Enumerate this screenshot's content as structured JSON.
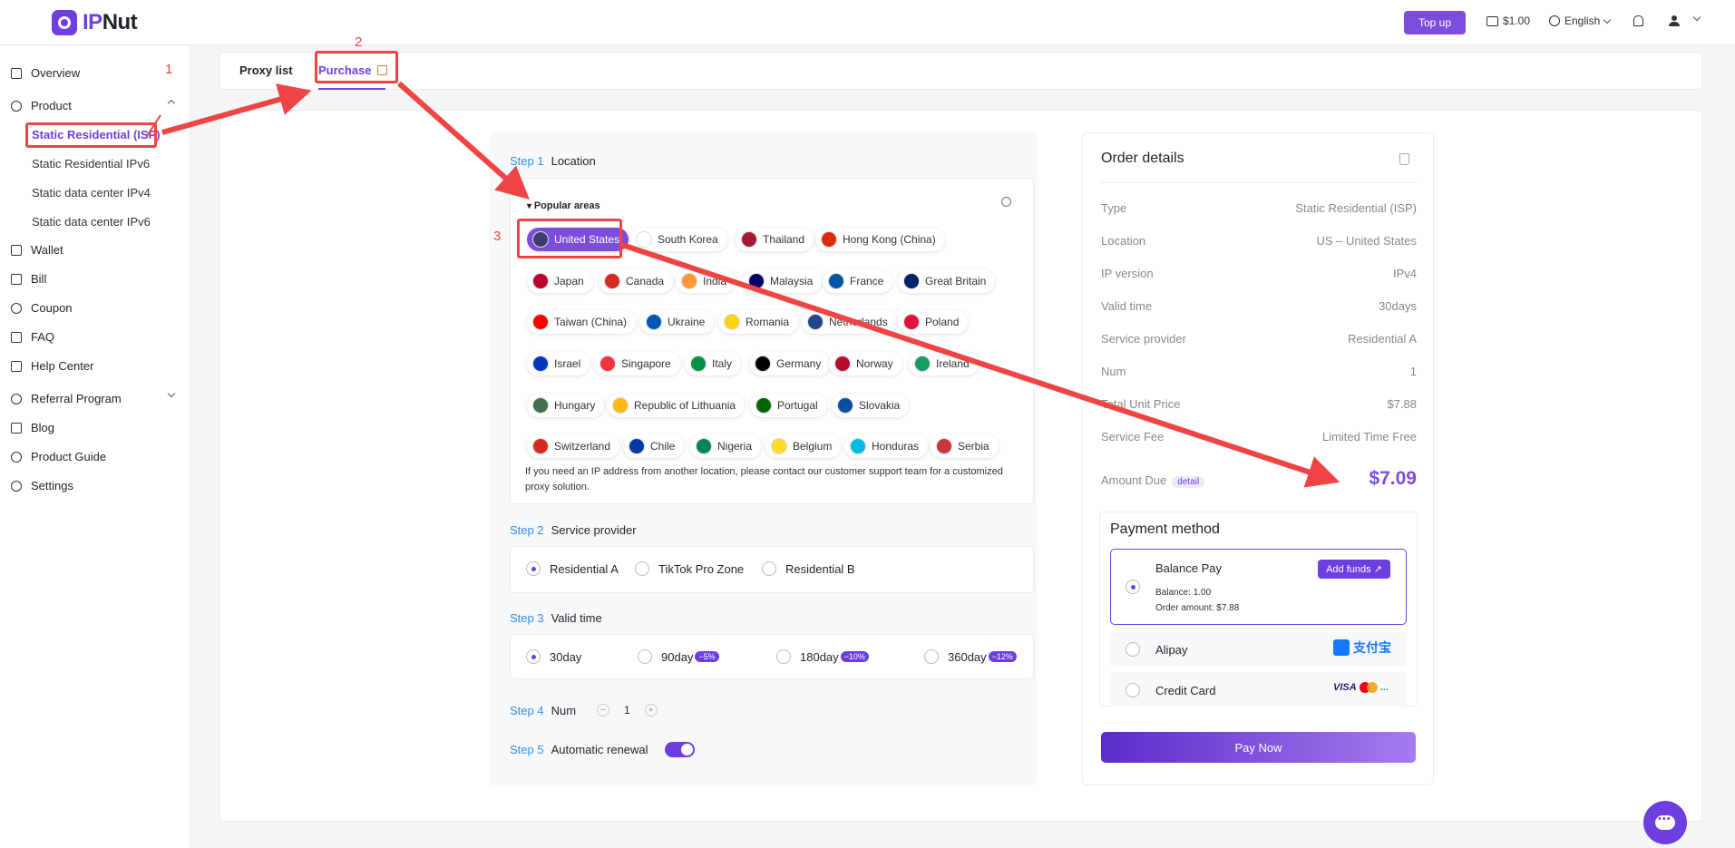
{
  "header": {
    "logo_text_accent": "IP",
    "logo_text": "Nut",
    "topup_label": "Top up",
    "balance": "$1.00",
    "language": "English"
  },
  "sidebar": {
    "items": [
      {
        "label": "Overview"
      },
      {
        "label": "Product"
      },
      {
        "label": "Wallet"
      },
      {
        "label": "Bill"
      },
      {
        "label": "Coupon"
      },
      {
        "label": "FAQ"
      },
      {
        "label": "Help Center"
      },
      {
        "label": "Referral Program"
      },
      {
        "label": "Blog"
      },
      {
        "label": "Product Guide"
      },
      {
        "label": "Settings"
      }
    ],
    "product_sub": [
      {
        "label": "Static Residential (ISP)"
      },
      {
        "label": "Static Residential IPv6"
      },
      {
        "label": "Static data center IPv4"
      },
      {
        "label": "Static data center IPv6"
      }
    ]
  },
  "tabs": [
    {
      "label": "Proxy list"
    },
    {
      "label": "Purchase"
    }
  ],
  "steps": {
    "step1": {
      "num": "Step 1",
      "label": "Location"
    },
    "step2": {
      "num": "Step 2",
      "label": "Service provider"
    },
    "step3": {
      "num": "Step 3",
      "label": "Valid time"
    },
    "step4": {
      "num": "Step 4",
      "label": "Num"
    },
    "step5": {
      "num": "Step 5",
      "label": "Automatic renewal"
    }
  },
  "location": {
    "popular_title": "Popular areas",
    "countries": [
      "United States",
      "South Korea",
      "Thailand",
      "Hong Kong (China)",
      "Japan",
      "Canada",
      "India",
      "Malaysia",
      "France",
      "Great Britain",
      "Taiwan (China)",
      "Ukraine",
      "Romania",
      "Netherlands",
      "Poland",
      "Israel",
      "Singapore",
      "Italy",
      "Germany",
      "Norway",
      "Ireland",
      "Hungary",
      "Republic of Lithuania",
      "Portugal",
      "Slovakia",
      "Switzerland",
      "Chile",
      "Nigeria",
      "Belgium",
      "Honduras",
      "Serbia"
    ],
    "selected": "United States",
    "note": "If you need an IP address from another location, please contact our customer support team for a customized proxy solution."
  },
  "providers": [
    "Residential A",
    "TikTok Pro Zone",
    "Residential B"
  ],
  "valid_times": [
    {
      "label": "30day",
      "discount": ""
    },
    {
      "label": "90day",
      "discount": "−5%"
    },
    {
      "label": "180day",
      "discount": "−10%"
    },
    {
      "label": "360day",
      "discount": "−12%"
    }
  ],
  "num": {
    "value": "1",
    "minus": "−",
    "plus": "+"
  },
  "order": {
    "title": "Order details",
    "rows": [
      {
        "label": "Type",
        "value": "Static Residential (ISP)"
      },
      {
        "label": "Location",
        "value": "US – United States"
      },
      {
        "label": "IP version",
        "value": "IPv4"
      },
      {
        "label": "Valid time",
        "value": "30days"
      },
      {
        "label": "Service provider",
        "value": "Residential A"
      },
      {
        "label": "Num",
        "value": "1"
      },
      {
        "label": "Total Unit Price",
        "value": "$7.88"
      },
      {
        "label": "Service Fee",
        "value": "Limited Time Free"
      }
    ],
    "amount_due_label": "Amount Due",
    "detail_label": "detail",
    "amount_due": "$7.09"
  },
  "payment": {
    "title": "Payment method",
    "balance_pay": "Balance Pay",
    "add_funds": "Add funds ↗",
    "balance_line": "Balance: 1.00",
    "order_amount_line": "Order amount: $7.88",
    "alipay": "Alipay",
    "alipay_logo": "支付宝",
    "credit_card": "Credit Card",
    "visa": "VISA",
    "more": "...",
    "pay_now": "Pay Now"
  },
  "annotations": [
    "1",
    "2",
    "3"
  ],
  "colors": {
    "accent": "#6d3fe0",
    "annotation": "#ef4444",
    "step_number": "#2f8fe8"
  }
}
